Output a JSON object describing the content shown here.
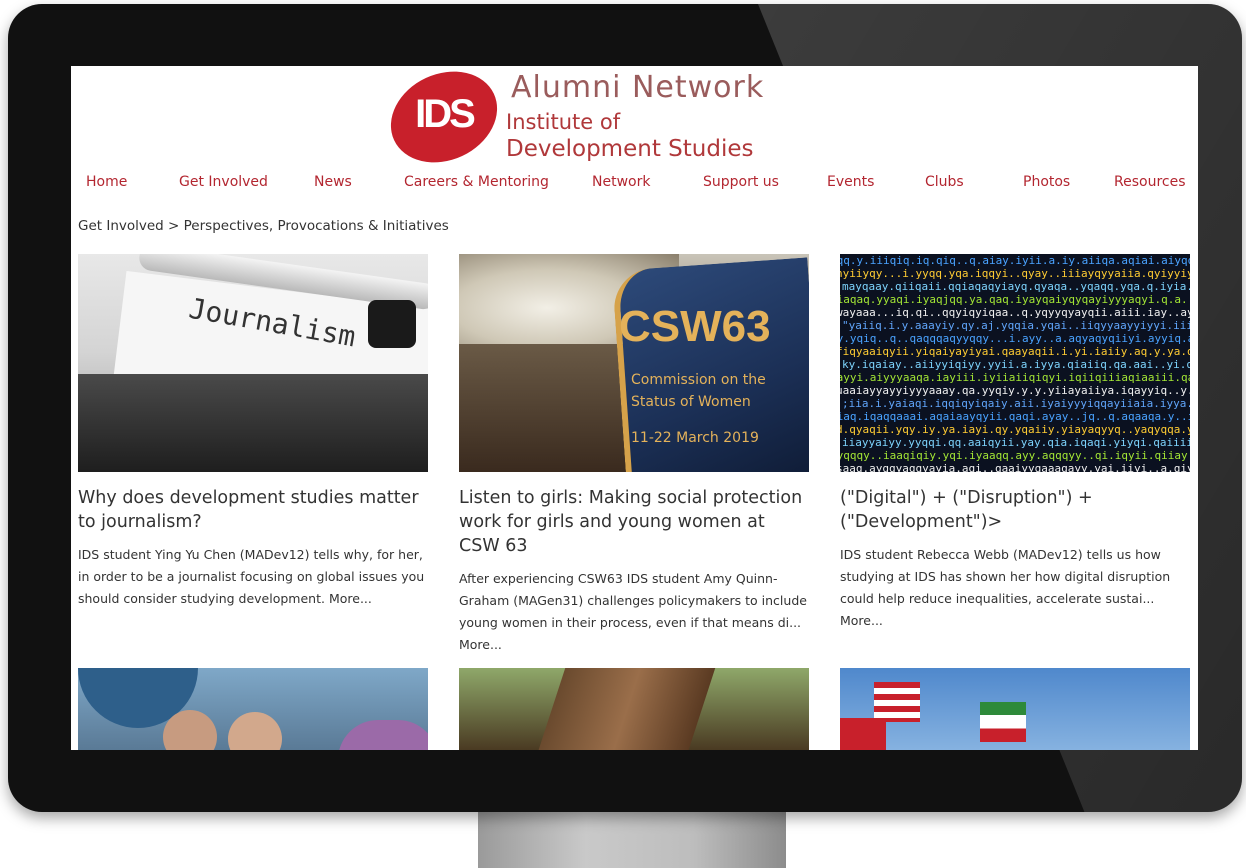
{
  "logo": {
    "mark": "IDS",
    "title": "Alumni Network",
    "subtitle_line1": "Institute of",
    "subtitle_line2": "Development Studies"
  },
  "nav": {
    "items": [
      {
        "label": "Home"
      },
      {
        "label": "Get Involved"
      },
      {
        "label": "News"
      },
      {
        "label": "Careers & Mentoring"
      },
      {
        "label": "Network"
      },
      {
        "label": "Support us"
      },
      {
        "label": "Events"
      },
      {
        "label": "Clubs"
      },
      {
        "label": "Photos"
      },
      {
        "label": "Resources"
      }
    ]
  },
  "breadcrumb": "Get Involved > Perspectives, Provocations & Initiatives",
  "cards": [
    {
      "title": "Why does development studies matter to journalism?",
      "text": "IDS student Ying Yu Chen (MADev12) tells why, for her, in order to be a journalist focusing on global issues you should consider studying development.",
      "more": "More...",
      "image_text": "Journalism"
    },
    {
      "title": "Listen to girls: Making social protection work for girls and young women at CSW 63",
      "text": "After experiencing CSW63 IDS student Amy Quinn-Graham (MAGen31) challenges policymakers to include young women in their process, even if that means di...",
      "more": "More...",
      "image_text": {
        "big": "CSW63",
        "line1": "Commission on the",
        "line2": "Status of Women",
        "line3": "11-22 March 2019"
      }
    },
    {
      "title": "(\"Digital\") + (\"Disruption\") + (\"Development\")>",
      "text": "IDS student Rebecca Webb (MADev12) tells us how studying at IDS has shown her how digital disruption could help reduce inequalities, accelerate sustai...",
      "more": "More..."
    }
  ],
  "colors": {
    "brand_red": "#c8202b",
    "nav_red": "#b32630",
    "logo_text": "#b0383a"
  }
}
